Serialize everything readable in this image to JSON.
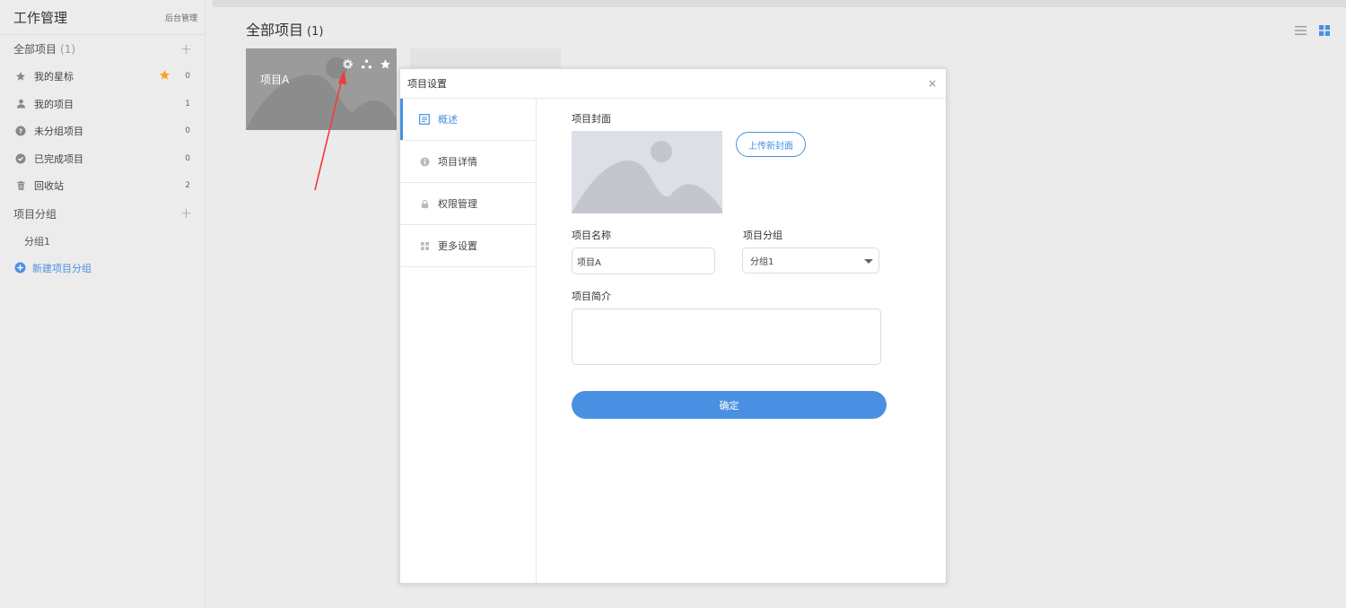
{
  "sidebar": {
    "title": "工作管理",
    "admin_link": "后台管理",
    "all_projects": {
      "label": "全部项目",
      "count": "(1)"
    },
    "items": [
      {
        "label": "我的星标",
        "count": "0",
        "icon": "star-icon"
      },
      {
        "label": "我的项目",
        "count": "1",
        "icon": "user-icon"
      },
      {
        "label": "未分组项目",
        "count": "0",
        "icon": "question-icon"
      },
      {
        "label": "已完成项目",
        "count": "0",
        "icon": "check-circle-icon"
      },
      {
        "label": "回收站",
        "count": "2",
        "icon": "trash-icon"
      }
    ],
    "groups_header": "项目分组",
    "groups": [
      "分组1"
    ],
    "new_group": "新建项目分组"
  },
  "main": {
    "title": "全部项目",
    "count": "(1)",
    "projects": [
      {
        "name": "项目A"
      }
    ]
  },
  "modal": {
    "title": "项目设置",
    "close": "×",
    "tabs": [
      "概述",
      "项目详情",
      "权限管理",
      "更多设置"
    ],
    "cover_label": "项目封面",
    "upload_label": "上传新封面",
    "name_label": "项目名称",
    "name_value": "项目A",
    "group_label": "项目分组",
    "group_value": "分组1",
    "desc_label": "项目简介",
    "desc_value": "",
    "confirm": "确定"
  },
  "colors": {
    "accent": "#4a90e2",
    "star": "#f5a623",
    "annotation": "#f03c3c"
  }
}
